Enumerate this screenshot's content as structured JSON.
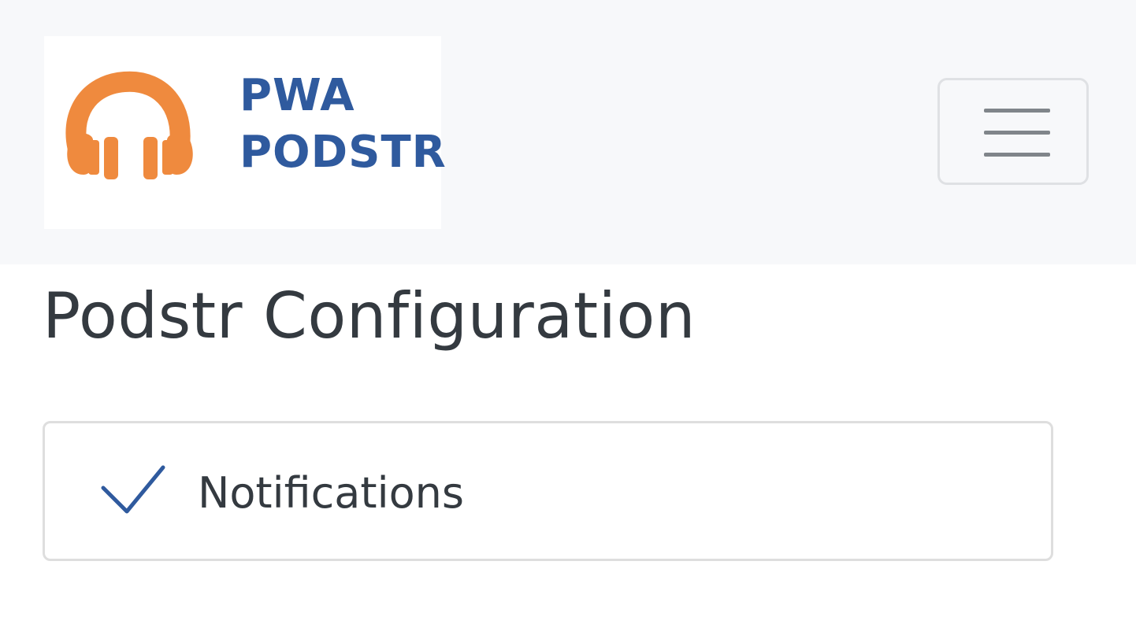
{
  "navbar": {
    "logo": {
      "line1": "PWA",
      "line2": "PODSTR",
      "icon": "headphones-icon",
      "colors": {
        "headphones": "#ef8a3e",
        "text": "#2f5a9e"
      }
    },
    "toggler": {
      "icon": "hamburger-menu-icon"
    }
  },
  "main": {
    "title": "Podstr Configuration",
    "settings": [
      {
        "label": "Notifications",
        "checked": true,
        "icon": "checkmark-icon"
      }
    ]
  },
  "colors": {
    "navbar_bg": "#f7f8fa",
    "accent": "#2f5a9e",
    "text": "#343a40",
    "border": "#dedede"
  }
}
